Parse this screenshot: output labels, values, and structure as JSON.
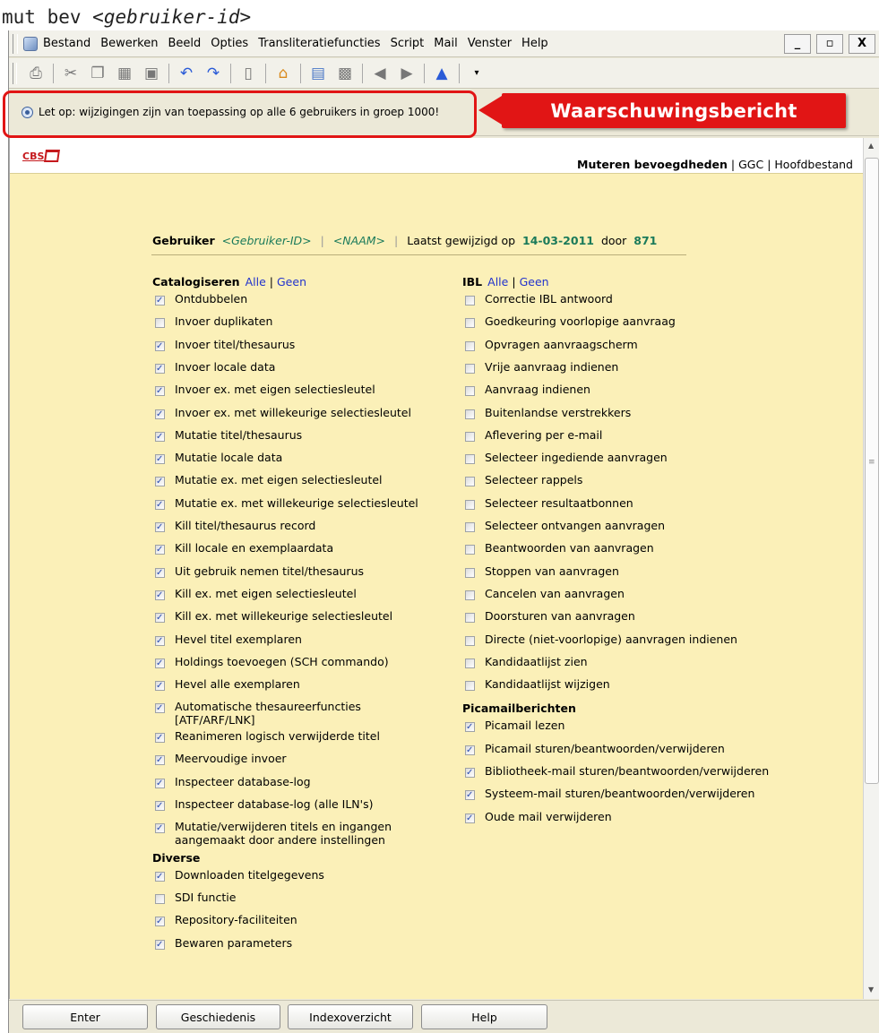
{
  "caption": {
    "command": "mut bev",
    "placeholder": "<gebruiker-id>"
  },
  "menubar": {
    "items": [
      "Bestand",
      "Bewerken",
      "Beeld",
      "Opties",
      "Transliteratiefuncties",
      "Script",
      "Mail",
      "Venster",
      "Help"
    ],
    "window_controls": [
      "_",
      "▫",
      "X"
    ]
  },
  "toolbar": {
    "icons": [
      "print-icon",
      "cut-icon",
      "copy-icon",
      "paste-icon",
      "save-icon",
      "undo-icon",
      "redo-icon",
      "doc-icon",
      "home-icon",
      "window-icon",
      "window2-icon",
      "back-icon",
      "forward-icon",
      "up-icon",
      "dropdown-icon"
    ]
  },
  "warning": {
    "text": "Let op: wijzigingen zijn van toepassing op alle 6 gebruikers in groep 1000!",
    "callout": "Waarschuwingsbericht"
  },
  "header": {
    "logo": "CBS",
    "nav": {
      "active": "Muteren bevoegdheden",
      "sep": "|",
      "link1": "GGC",
      "link2": "Hoofdbestand"
    }
  },
  "user": {
    "label": "Gebruiker",
    "id": "<Gebruiker-ID>",
    "sep": "|",
    "name": "<NAAM>",
    "changed_label": "Laatst gewijzigd op",
    "date": "14-03-2011",
    "by_label": "door",
    "by": "871"
  },
  "links": {
    "all": "Alle",
    "none": "Geen",
    "sep": "|"
  },
  "sections": {
    "catalog": {
      "title": "Catalogiseren",
      "items": [
        {
          "label": "Ontdubbelen",
          "checked": true
        },
        {
          "label": "Invoer duplikaten",
          "checked": false
        },
        {
          "label": "Invoer titel/thesaurus",
          "checked": true
        },
        {
          "label": "Invoer locale data",
          "checked": true
        },
        {
          "label": "Invoer ex. met eigen selectiesleutel",
          "checked": true
        },
        {
          "label": "Invoer ex. met willekeurige selectiesleutel",
          "checked": true
        },
        {
          "label": "Mutatie titel/thesaurus",
          "checked": true
        },
        {
          "label": "Mutatie locale data",
          "checked": true
        },
        {
          "label": "Mutatie ex. met eigen selectiesleutel",
          "checked": true
        },
        {
          "label": "Mutatie ex. met willekeurige selectiesleutel",
          "checked": true
        },
        {
          "label": "Kill titel/thesaurus record",
          "checked": true
        },
        {
          "label": "Kill locale en exemplaardata",
          "checked": true
        },
        {
          "label": "Uit gebruik nemen titel/thesaurus",
          "checked": true
        },
        {
          "label": "Kill ex. met eigen selectiesleutel",
          "checked": true
        },
        {
          "label": "Kill ex. met willekeurige selectiesleutel",
          "checked": true
        },
        {
          "label": "Hevel titel exemplaren",
          "checked": true
        },
        {
          "label": "Holdings toevoegen (SCH commando)",
          "checked": true
        },
        {
          "label": "Hevel alle exemplaren",
          "checked": true
        },
        {
          "label": "Automatische thesaureerfuncties",
          "label2": "[ATF/ARF/LNK]",
          "checked": true
        },
        {
          "label": "Reanimeren logisch verwijderde titel",
          "checked": true
        },
        {
          "label": "Meervoudige invoer",
          "checked": true
        },
        {
          "label": "Inspecteer database-log",
          "checked": true
        },
        {
          "label": "Inspecteer database-log (alle ILN's)",
          "checked": true
        },
        {
          "label": "Mutatie/verwijderen titels en ingangen",
          "label2": "aangemaakt door andere instellingen",
          "checked": true
        }
      ]
    },
    "diverse": {
      "title": "Diverse",
      "items": [
        {
          "label": "Downloaden titelgegevens",
          "checked": true
        },
        {
          "label": "SDI functie",
          "checked": false
        },
        {
          "label": "Repository-faciliteiten",
          "checked": true
        },
        {
          "label": "Bewaren parameters",
          "checked": true
        }
      ]
    },
    "ibl": {
      "title": "IBL",
      "items": [
        {
          "label": "Correctie IBL antwoord",
          "checked": false
        },
        {
          "label": "Goedkeuring voorlopige aanvraag",
          "checked": false
        },
        {
          "label": "Opvragen aanvraagscherm",
          "checked": false
        },
        {
          "label": "Vrije aanvraag indienen",
          "checked": false
        },
        {
          "label": "Aanvraag indienen",
          "checked": false
        },
        {
          "label": "Buitenlandse verstrekkers",
          "checked": false
        },
        {
          "label": "Aflevering per e-mail",
          "checked": false
        },
        {
          "label": "Selecteer ingediende aanvragen",
          "checked": false
        },
        {
          "label": "Selecteer rappels",
          "checked": false
        },
        {
          "label": "Selecteer resultaatbonnen",
          "checked": false
        },
        {
          "label": "Selecteer ontvangen aanvragen",
          "checked": false
        },
        {
          "label": "Beantwoorden van aanvragen",
          "checked": false
        },
        {
          "label": "Stoppen van aanvragen",
          "checked": false
        },
        {
          "label": "Cancelen van aanvragen",
          "checked": false
        },
        {
          "label": "Doorsturen van aanvragen",
          "checked": false
        },
        {
          "label": "Directe (niet-voorlopige) aanvragen indienen",
          "checked": false
        },
        {
          "label": "Kandidaatlijst zien",
          "checked": false
        },
        {
          "label": "Kandidaatlijst wijzigen",
          "checked": false
        }
      ]
    },
    "picamail": {
      "title": "Picamailberichten",
      "items": [
        {
          "label": "Picamail lezen",
          "checked": true
        },
        {
          "label": "Picamail sturen/beantwoorden/verwijderen",
          "checked": true
        },
        {
          "label": "Bibliotheek-mail sturen/beantwoorden/verwijderen",
          "checked": true
        },
        {
          "label": "Systeem-mail sturen/beantwoorden/verwijderen",
          "checked": true
        },
        {
          "label": "Oude mail verwijderen",
          "checked": true
        }
      ]
    }
  },
  "buttons": {
    "enter": "Enter",
    "history": "Geschiedenis",
    "index": "Indexoverzicht",
    "help": "Help"
  },
  "colors": {
    "content_bg": "#fbf0b8",
    "warning_red": "#e11515",
    "link_blue": "#2233cc",
    "value_green": "#1a7a5a"
  }
}
